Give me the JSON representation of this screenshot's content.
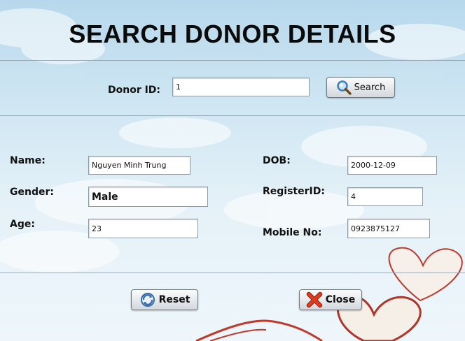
{
  "title": "SEARCH DONOR DETAILS",
  "search": {
    "label": "Donor ID:",
    "value": "1",
    "button_label": "Search",
    "button_icon": "magnifier-icon"
  },
  "details": {
    "name_label": "Name:",
    "name_value": "Nguyen Minh Trung",
    "gender_label": "Gender:",
    "gender_value": "Male",
    "age_label": "Age:",
    "age_value": "23",
    "dob_label": "DOB:",
    "dob_value": "2000-12-09",
    "registerid_label": "RegisterID:",
    "registerid_value": "4",
    "mobile_label": "Mobile No:",
    "mobile_value": "0923875127"
  },
  "actions": {
    "reset_label": "Reset",
    "reset_icon": "refresh-icon",
    "close_label": "Close",
    "close_icon": "close-x-icon"
  },
  "colors": {
    "background": "#cfe6f3",
    "title": "#0b0b0b",
    "heart_outline": "#c0392b",
    "close_icon": "#e03a1e",
    "search_icon": "#3b7fc4"
  }
}
